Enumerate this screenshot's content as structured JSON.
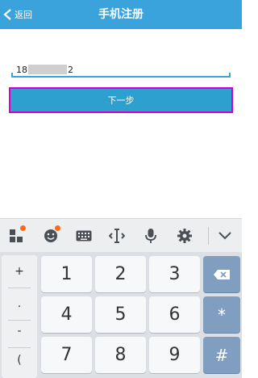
{
  "header": {
    "back_label": "返回",
    "title": "手机注册"
  },
  "form": {
    "phone_prefix": "18",
    "phone_suffix": "2",
    "next_label": "下一步"
  },
  "keyboard": {
    "symbols": [
      "+",
      ".",
      "-",
      "("
    ],
    "digits": [
      "1",
      "2",
      "3",
      "4",
      "5",
      "6",
      "7",
      "8",
      "9"
    ],
    "func_keys": [
      "*",
      "#"
    ]
  },
  "colors": {
    "accent": "#3aa3dc",
    "button": "#2ea0cf",
    "highlight_border": "#d000d0",
    "badge": "#ff6a1a",
    "func_key": "#7f9ec0"
  }
}
